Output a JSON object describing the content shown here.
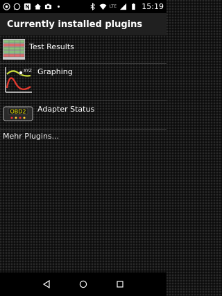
{
  "status_bar": {
    "time": "15:19",
    "network": "LTE",
    "icons": [
      "chrome-icon",
      "whatsapp-icon",
      "nfc-icon",
      "home-icon",
      "camera-icon",
      "more-icon",
      "bluetooth-icon",
      "wifi-icon",
      "signal-icon",
      "battery-icon"
    ]
  },
  "header": {
    "title": "Currently installed plugins"
  },
  "plugins": [
    {
      "label": "Test Results",
      "icon": "test-results-icon"
    },
    {
      "label": "Graphing",
      "icon": "graphing-icon",
      "icon_text": "XYZ"
    },
    {
      "label": "Adapter Status",
      "icon": "adapter-status-icon",
      "icon_text": "OBD2"
    }
  ],
  "more_plugins": {
    "label": "Mehr Plugins..."
  },
  "nav_bar": {
    "buttons": [
      "back-icon",
      "home-icon",
      "recents-icon"
    ]
  }
}
